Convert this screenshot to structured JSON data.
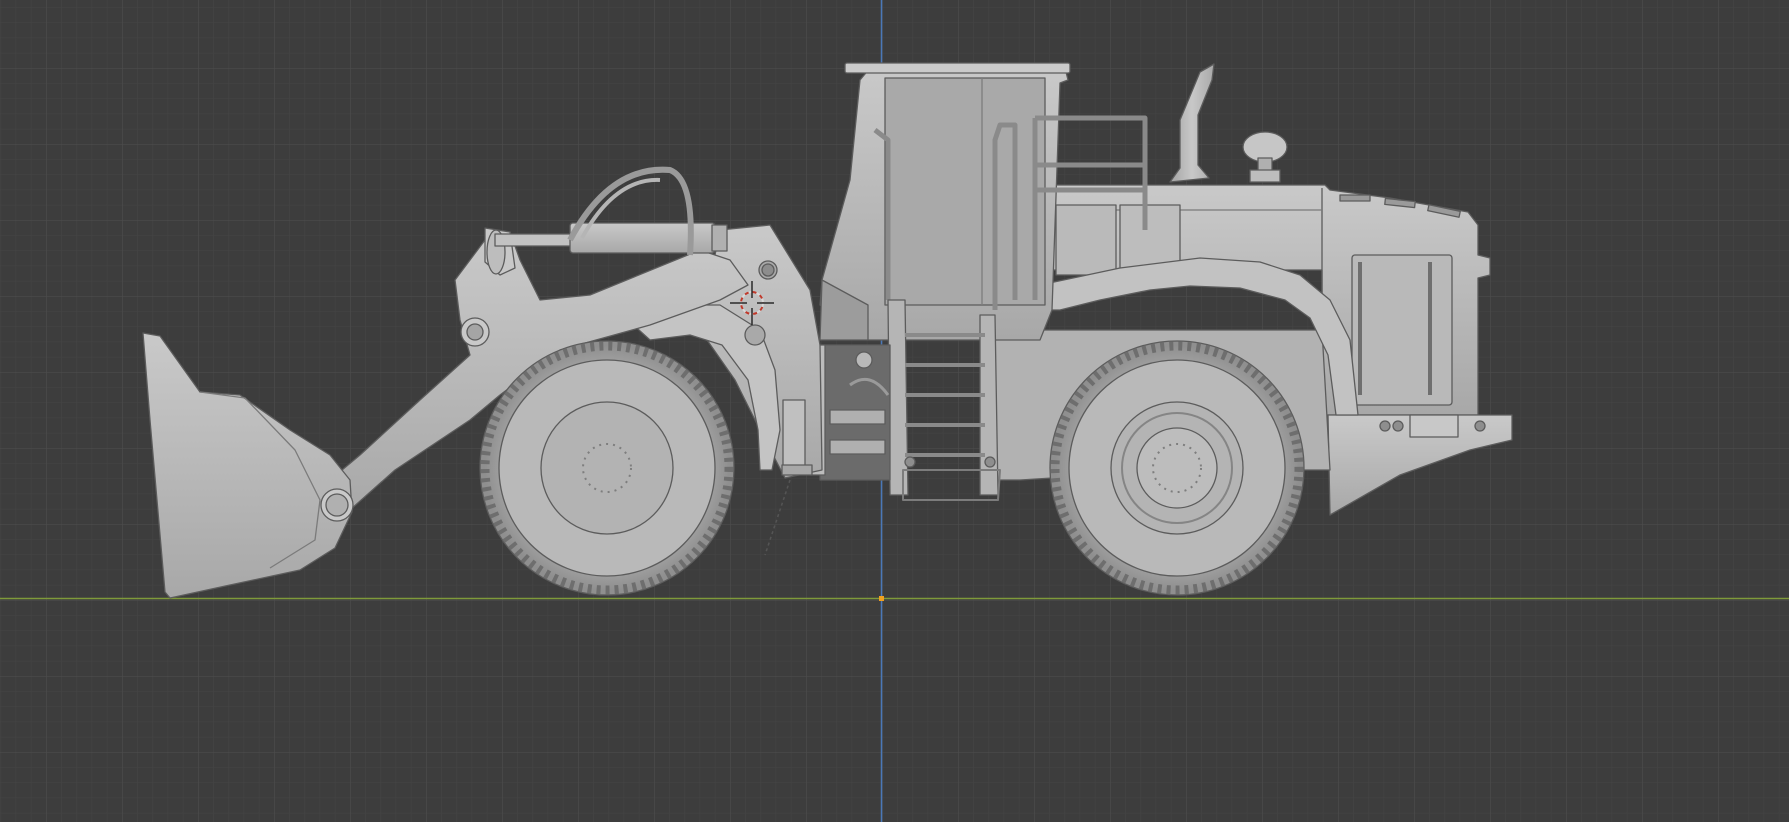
{
  "viewport": {
    "view": "orthographic-side",
    "grid": true,
    "colors": {
      "background": "#3d3d3d",
      "grid_minor": "#454545",
      "grid_major": "#4b4b4b",
      "axis_x": "#7f9a3a",
      "axis_z": "#4a78b8",
      "origin": "#f0a020",
      "model_base": "#b5b5b5",
      "model_light": "#cfcfcf",
      "model_dark": "#8a8a8a",
      "edge": "#5f5f5f"
    }
  },
  "model": {
    "object": "wheel-loader",
    "shading": "solid",
    "parts": [
      "bucket",
      "lift-arm",
      "hydraulic-cylinder",
      "front-wheel",
      "rear-wheel",
      "cab",
      "ladder",
      "handrail",
      "exhaust-stack",
      "air-intake",
      "engine-hood",
      "counterweight",
      "fender-front",
      "fender-rear"
    ]
  },
  "cursor_3d": {
    "icon": "3d-cursor-icon"
  }
}
